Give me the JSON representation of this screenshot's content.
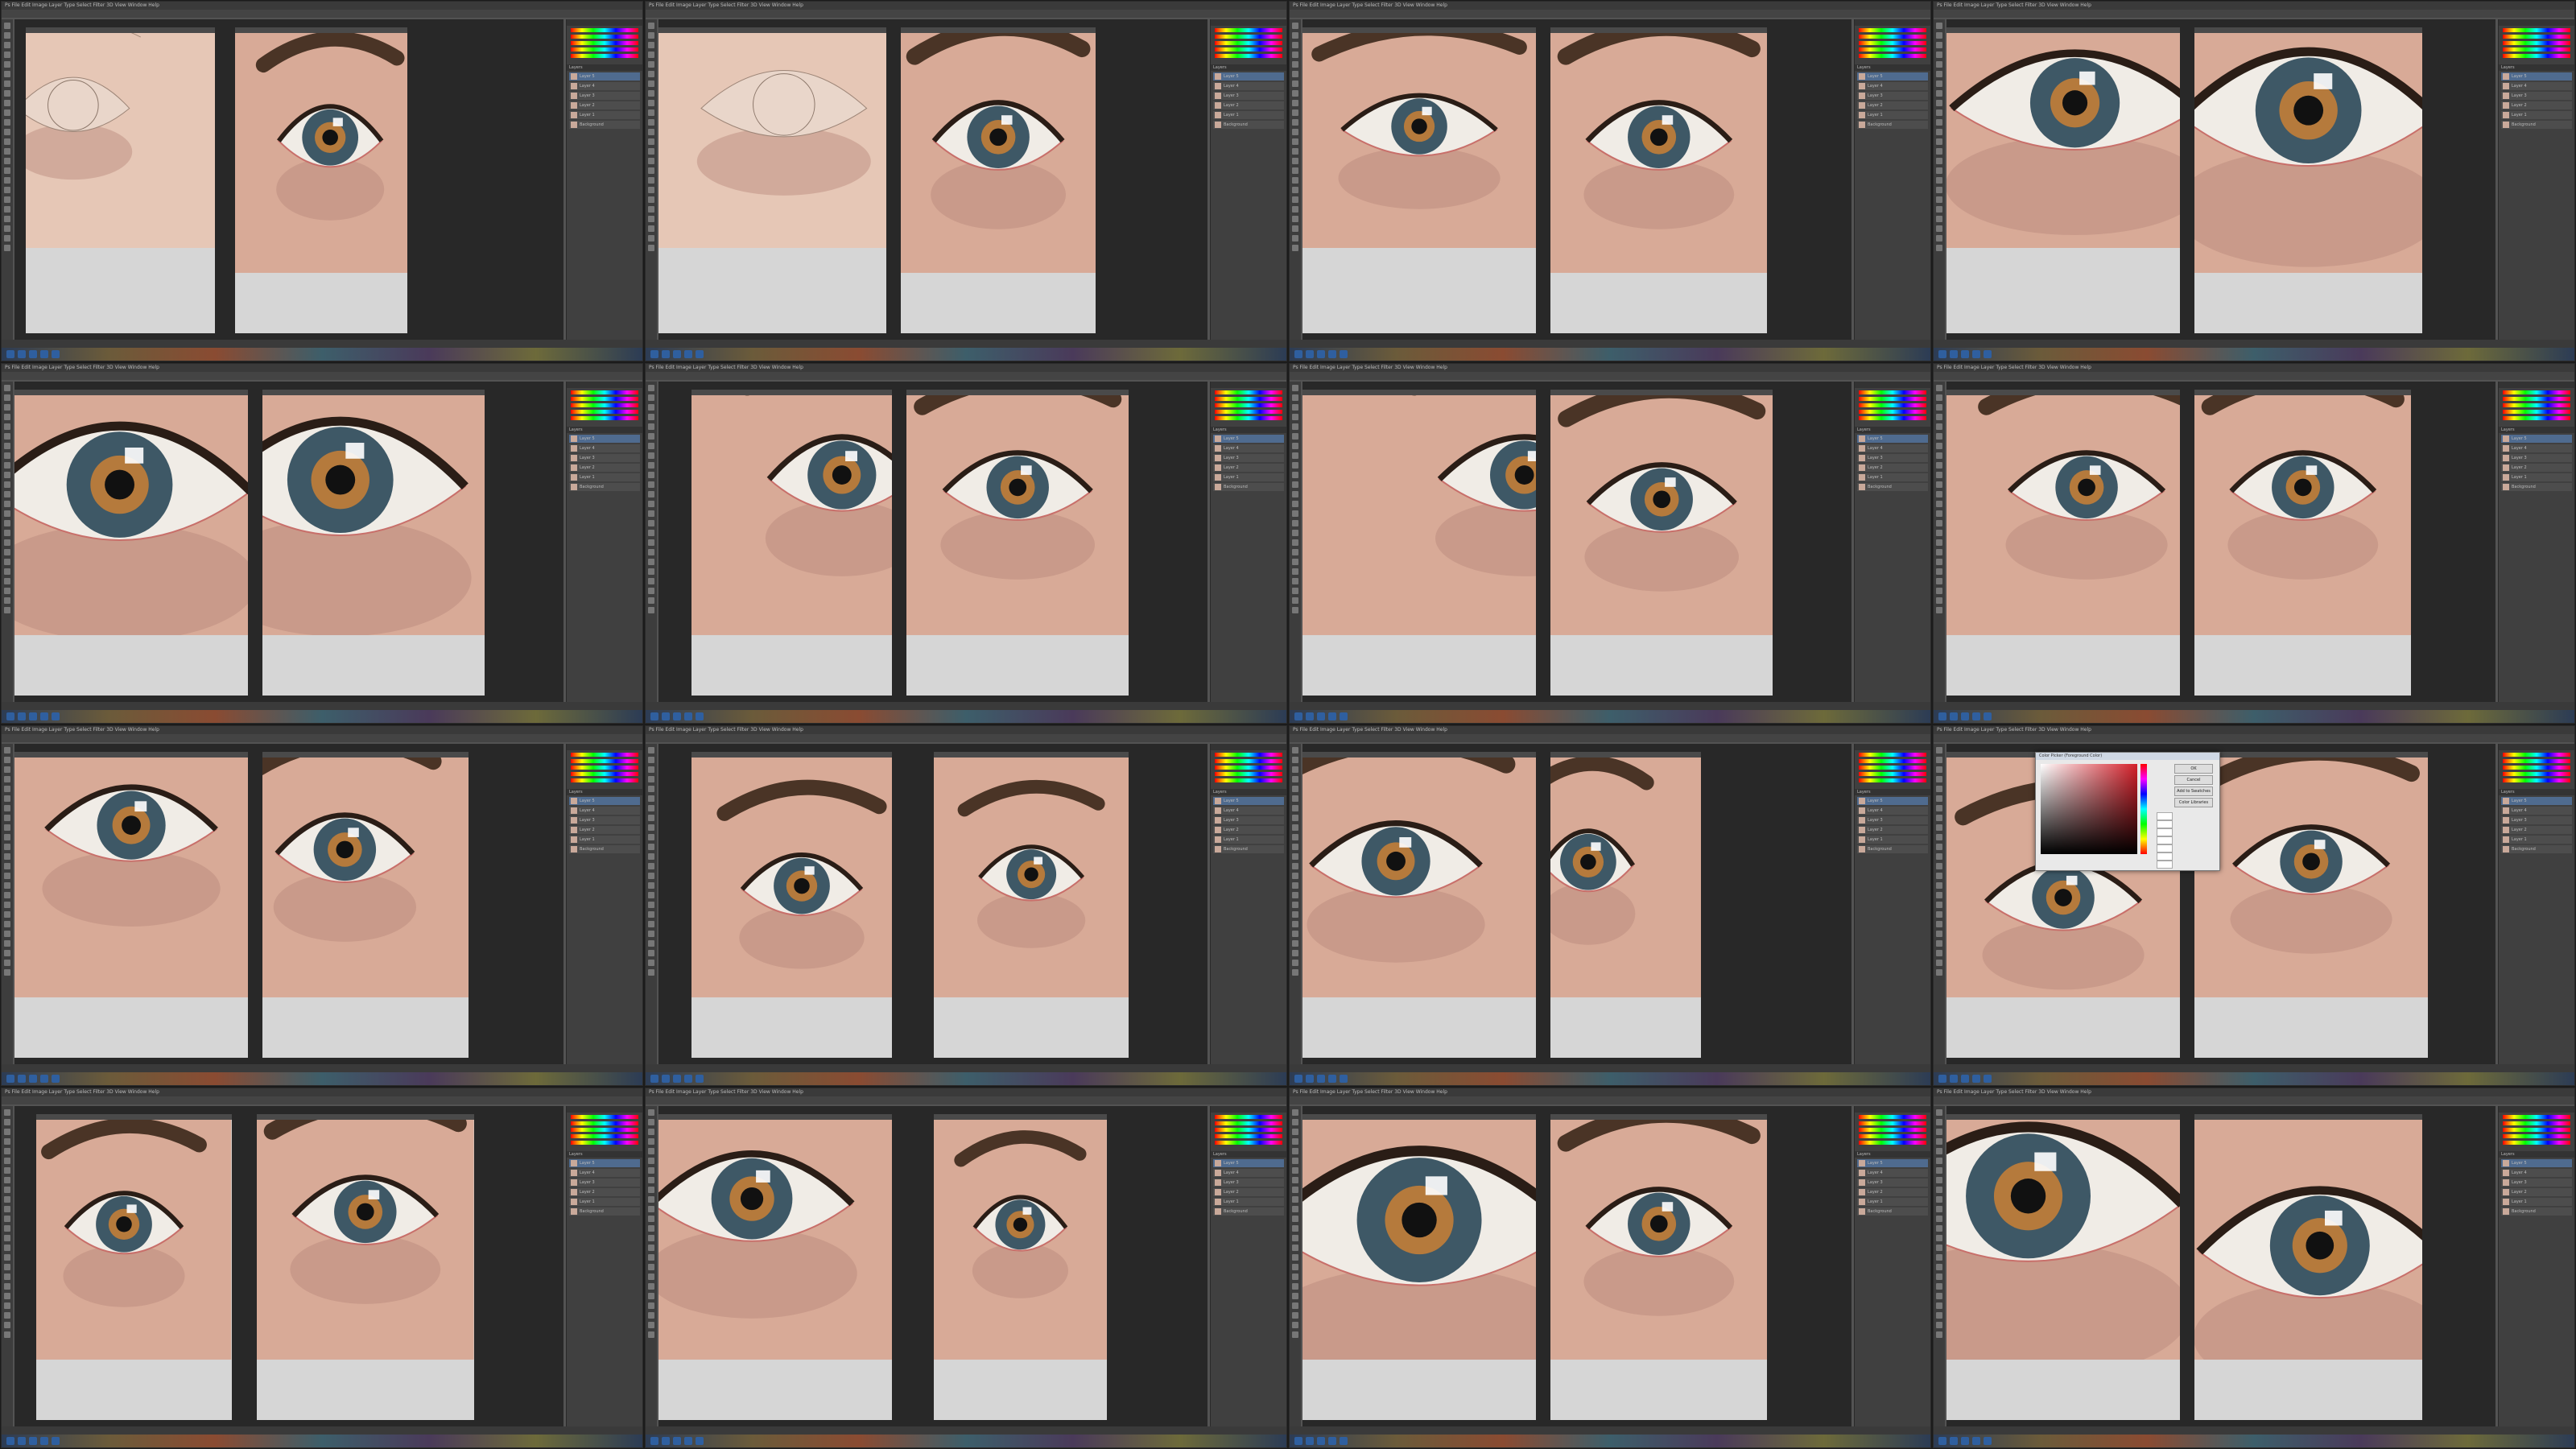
{
  "app": {
    "menu_label": "Ps  File  Edit  Image  Layer  Type  Select  Filter  3D  View  Window  Help",
    "doc_title": "",
    "zoom": "",
    "status": ""
  },
  "colors": {
    "skin": "#d8aa97",
    "skin_shadow": "#b9877a",
    "iris_outer": "#3e5866",
    "iris_inner": "#b57a3c",
    "sclera": "#f0ece6",
    "brow": "#4a3426",
    "lid_rim": "#c86f6a",
    "canvas_bg": "#d6d6d6",
    "ui_bg": "#535353"
  },
  "icons": [
    "move-tool-icon",
    "marquee-tool-icon",
    "lasso-tool-icon",
    "brush-tool-icon",
    "eraser-tool-icon",
    "zoom-tool-icon",
    "layer-thumb-icon",
    "eye-visibility-icon"
  ],
  "layers_panel": {
    "title": "Layers",
    "layers": [
      "Layer 5",
      "Layer 4",
      "Layer 3",
      "Layer 2",
      "Layer 1",
      "Background"
    ]
  },
  "color_picker": {
    "title": "Color Picker (Foreground Color)",
    "ok_label": "OK",
    "cancel_label": "Cancel",
    "add_swatches_label": "Add to Swatches",
    "libraries_label": "Color Libraries"
  }
}
